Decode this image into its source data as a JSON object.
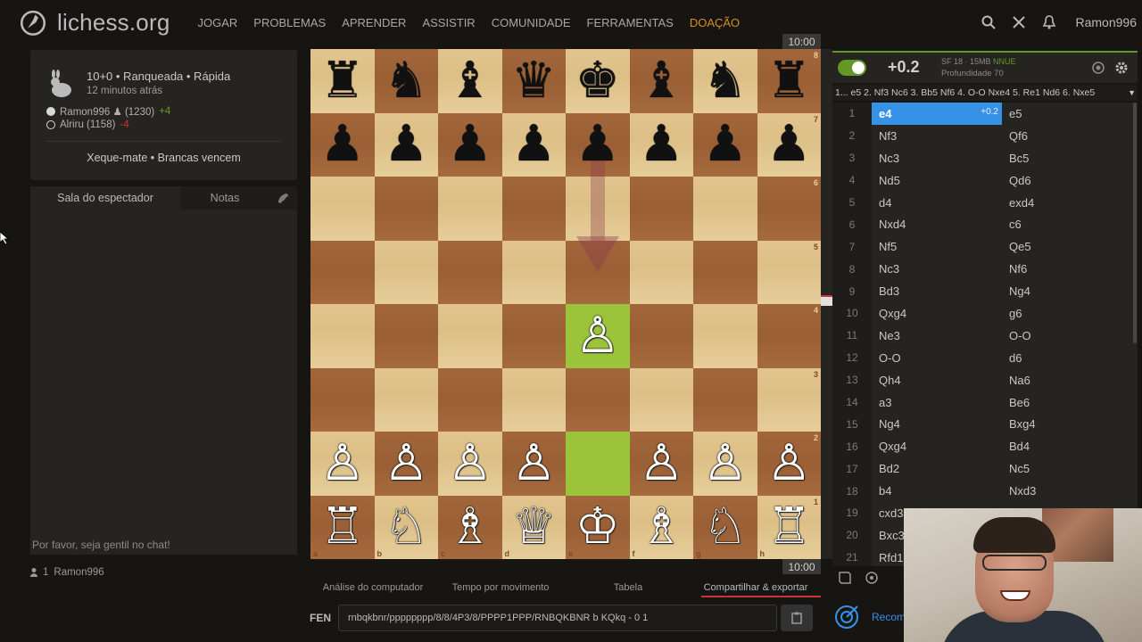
{
  "site": {
    "name": "lichess.org"
  },
  "nav": [
    "JOGAR",
    "PROBLEMAS",
    "APRENDER",
    "ASSISTIR",
    "COMUNIDADE",
    "FERRAMENTAS",
    "DOAÇÃO"
  ],
  "user": {
    "name": "Ramon996"
  },
  "game": {
    "title": "10+0 • Ranqueada • Rápida",
    "time_ago": "12 minutos atrás",
    "white": {
      "name": "Ramon996 ♟ (1230)",
      "diff": "+4"
    },
    "black": {
      "name": "Alriru (1158)",
      "diff": "-4"
    },
    "result": "Xeque-mate • Brancas vencem"
  },
  "chat": {
    "tab_room": "Sala do espectador",
    "tab_notes": "Notas",
    "placeholder": "Por favor, seja gentil no chat!"
  },
  "spectators": {
    "count": "1",
    "name": "Ramon996"
  },
  "clocks": {
    "top": "10:00",
    "bottom": "10:00"
  },
  "board": {
    "ranks": [
      "8",
      "7",
      "6",
      "5",
      "4",
      "3",
      "2",
      "1"
    ],
    "files": [
      "a",
      "b",
      "c",
      "d",
      "e",
      "f",
      "g",
      "h"
    ],
    "position": [
      [
        "♜",
        "♞",
        "♝",
        "♛",
        "♚",
        "♝",
        "♞",
        "♜"
      ],
      [
        "♟",
        "♟",
        "♟",
        "♟",
        "♟",
        "♟",
        "♟",
        "♟"
      ],
      [
        "",
        "",
        "",
        "",
        "",
        "",
        "",
        ""
      ],
      [
        "",
        "",
        "",
        "",
        "",
        "",
        "",
        ""
      ],
      [
        "",
        "",
        "",
        "",
        "♙",
        "",
        "",
        ""
      ],
      [
        "",
        "",
        "",
        "",
        "",
        "",
        "",
        ""
      ],
      [
        "♙",
        "♙",
        "♙",
        "♙",
        "",
        "♙",
        "♙",
        "♙"
      ],
      [
        "♖",
        "♘",
        "♗",
        "♕",
        "♔",
        "♗",
        "♘",
        "♖"
      ]
    ],
    "highlight_last_move": [
      "e2",
      "e4"
    ],
    "arrow": {
      "from": "e7",
      "to": "e5",
      "color": "#8a3a4a"
    }
  },
  "bottom_tabs": [
    "Análise do computador",
    "Tempo por movimento",
    "Tabela",
    "Compartilhar & exportar"
  ],
  "fen": {
    "label": "FEN",
    "value": "rnbqkbnr/pppppppp/8/8/4P3/8/PPPP1PPP/RNBQKBNR b KQkq - 0 1"
  },
  "ceval": {
    "score": "+0.2",
    "engine": "SF 18 · 15MB",
    "nnue": "NNUE",
    "depth": "Profundidade 70",
    "pv": "1... e5 2. Nf3 Nc6 3. Bb5 Nf6 4. O-O Nxe4 5. Re1 Nd6 6. Nxe5"
  },
  "moves": [
    {
      "n": "1",
      "w": "e4",
      "b": "e5",
      "eval": "+0.2"
    },
    {
      "n": "2",
      "w": "Nf3",
      "b": "Qf6"
    },
    {
      "n": "3",
      "w": "Nc3",
      "b": "Bc5"
    },
    {
      "n": "4",
      "w": "Nd5",
      "b": "Qd6"
    },
    {
      "n": "5",
      "w": "d4",
      "b": "exd4"
    },
    {
      "n": "6",
      "w": "Nxd4",
      "b": "c6"
    },
    {
      "n": "7",
      "w": "Nf5",
      "b": "Qe5"
    },
    {
      "n": "8",
      "w": "Nc3",
      "b": "Nf6"
    },
    {
      "n": "9",
      "w": "Bd3",
      "b": "Ng4"
    },
    {
      "n": "10",
      "w": "Qxg4",
      "b": "g6"
    },
    {
      "n": "11",
      "w": "Ne3",
      "b": "O-O"
    },
    {
      "n": "12",
      "w": "O-O",
      "b": "d6"
    },
    {
      "n": "13",
      "w": "Qh4",
      "b": "Na6"
    },
    {
      "n": "14",
      "w": "a3",
      "b": "Be6"
    },
    {
      "n": "15",
      "w": "Ng4",
      "b": "Bxg4"
    },
    {
      "n": "16",
      "w": "Qxg4",
      "b": "Bd4"
    },
    {
      "n": "17",
      "w": "Bd2",
      "b": "Nc5"
    },
    {
      "n": "18",
      "w": "b4",
      "b": "Nxd3"
    },
    {
      "n": "19",
      "w": "cxd3",
      "b": ""
    },
    {
      "n": "20",
      "w": "Bxc3",
      "b": ""
    },
    {
      "n": "21",
      "w": "Rfd1",
      "b": ""
    }
  ],
  "recommend": "Recom King's",
  "colors": {
    "accent": "#629924",
    "link": "#3692e7",
    "donate": "#d59020",
    "active_move": "#3692e7"
  }
}
